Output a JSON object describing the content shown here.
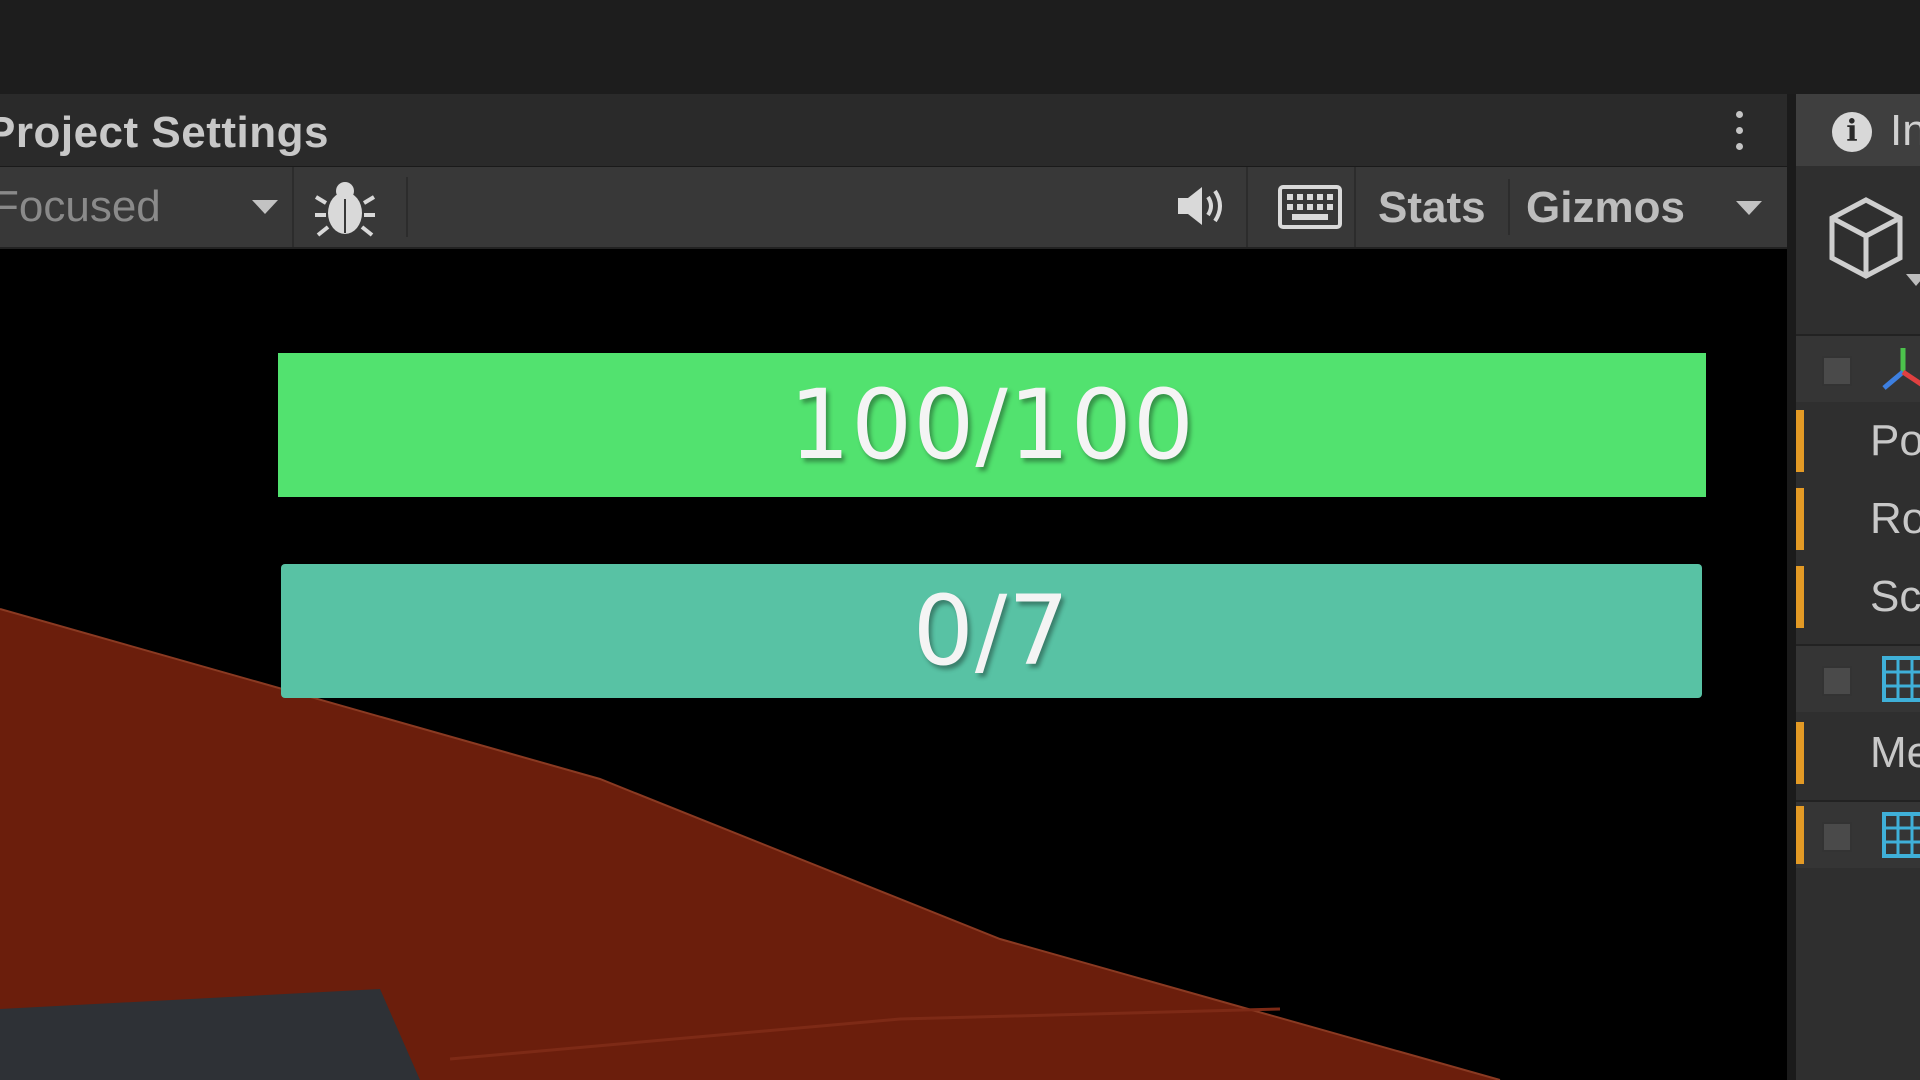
{
  "window": {
    "title": "Project Settings",
    "menu_icon": "kebab-menu-icon"
  },
  "toolbar": {
    "focus_dropdown": "Focused",
    "debug_icon": "bug-icon",
    "audio_icon": "speaker-icon",
    "keyboard_icon": "keyboard-icon",
    "stats_label": "Stats",
    "gizmos_label": "Gizmos"
  },
  "game_view": {
    "health_bar": {
      "text": "100/100",
      "value": 100,
      "max": 100,
      "color": "#52e26f"
    },
    "progress_bar": {
      "text": "0/7",
      "value": 0,
      "max": 7,
      "color": "#58c2a4"
    },
    "terrain_color": "#6b1e0c"
  },
  "inspector": {
    "tab_label": "In",
    "tab_icon": "info-icon",
    "object_icon": "cube-icon",
    "transform_rows": [
      {
        "label": "Po"
      },
      {
        "label": "Ro"
      },
      {
        "label": "Sc"
      }
    ],
    "mesh_row": {
      "label": "Me"
    },
    "accent_color": "#e39a25"
  }
}
